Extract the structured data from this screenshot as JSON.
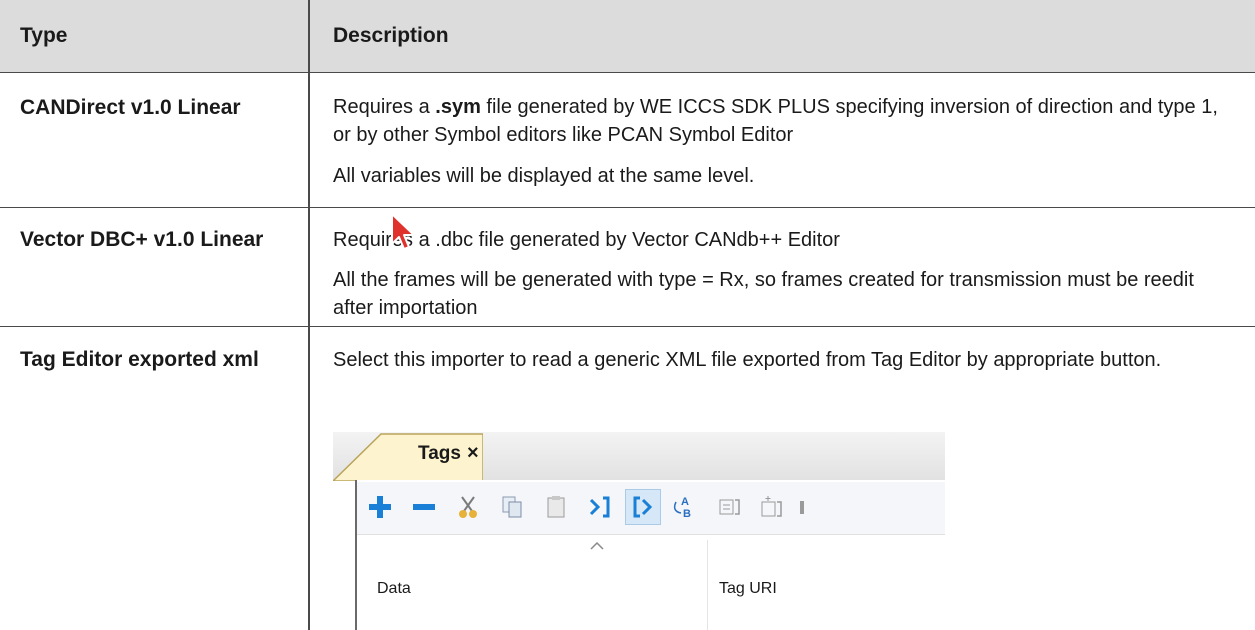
{
  "table": {
    "headers": {
      "type": "Type",
      "description": "Description"
    },
    "rows": [
      {
        "type": "CANDirect v1.0 Linear",
        "desc1_pre": "Requires a ",
        "desc1_bold": ".sym",
        "desc1_post": " file generated by WE ICCS SDK PLUS specifying inversion of direction and type 1, or by other Symbol editors like PCAN Symbol Editor",
        "desc2": "All variables will be displayed at the same level."
      },
      {
        "type": "Vector DBC+ v1.0 Linear",
        "desc1": "Requires a .dbc file generated by Vector CANdb++ Editor",
        "desc2": "All the frames will be generated with type = Rx, so frames created for transmission must be reedit after importation"
      },
      {
        "type": "Tag Editor exported xml",
        "desc1": "Select this importer to read a generic XML file exported from Tag Editor by appropriate button."
      }
    ]
  },
  "screenshot": {
    "tab_label": "Tags",
    "tab_close": "×",
    "columns": [
      "Data",
      "Tag URI"
    ],
    "toolbar_icons": [
      "add-icon",
      "remove-icon",
      "cut-icon",
      "copy-icon",
      "paste-icon",
      "export-icon",
      "import-icon",
      "rename-icon",
      "tag-edit-icon",
      "tag-add-icon"
    ],
    "colors": {
      "add": "#1a7fd6",
      "remove": "#1a7fd6",
      "active_bg": "#d6e8f7",
      "cursor": "#e0322c"
    }
  }
}
